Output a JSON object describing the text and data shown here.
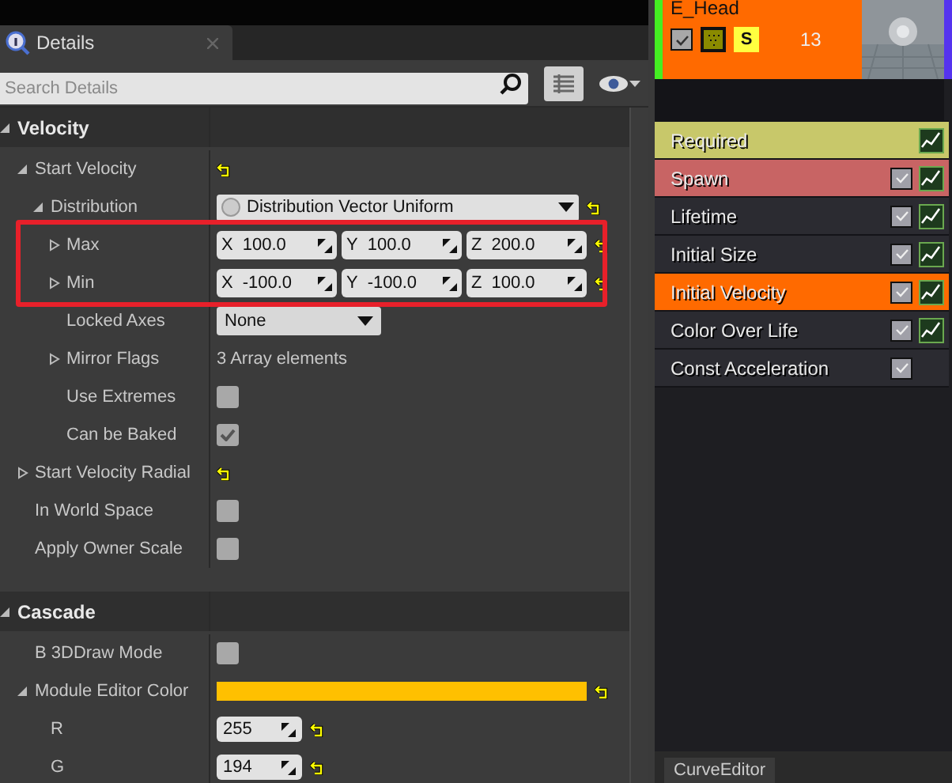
{
  "details": {
    "tab": "Details",
    "search": {
      "placeholder": "Search Details"
    },
    "sections": [
      {
        "title": "Velocity",
        "expanded": true,
        "rows": [
          {
            "label": "Start Velocity",
            "expanded": true,
            "kind": "none",
            "reset": true,
            "children": [
              {
                "label": "Distribution",
                "expanded": true,
                "kind": "dropdown",
                "value": "Distribution Vector Uniform",
                "reset": true,
                "children": [
                  {
                    "label": "Max",
                    "expanded": false,
                    "kind": "vector",
                    "highlighted": true,
                    "reset": true,
                    "values": [
                      {
                        "axis": "X",
                        "value": "100.0"
                      },
                      {
                        "axis": "Y",
                        "value": "100.0"
                      },
                      {
                        "axis": "Z",
                        "value": "200.0"
                      }
                    ]
                  },
                  {
                    "label": "Min",
                    "expanded": false,
                    "kind": "vector",
                    "highlighted": true,
                    "reset": true,
                    "values": [
                      {
                        "axis": "X",
                        "value": "-100.0"
                      },
                      {
                        "axis": "Y",
                        "value": "-100.0"
                      },
                      {
                        "axis": "Z",
                        "value": "100.0"
                      }
                    ]
                  },
                  {
                    "label": "Locked Axes",
                    "kind": "combo",
                    "value": "None"
                  },
                  {
                    "label": "Mirror Flags",
                    "expanded": false,
                    "kind": "text",
                    "value": "3 Array elements"
                  },
                  {
                    "label": "Use Extremes",
                    "kind": "checkbox",
                    "checked": false
                  },
                  {
                    "label": "Can be Baked",
                    "kind": "checkbox",
                    "checked": true
                  }
                ]
              }
            ]
          },
          {
            "label": "Start Velocity Radial",
            "expanded": false,
            "kind": "none",
            "reset": true
          },
          {
            "label": "In World Space",
            "kind": "checkbox",
            "checked": false
          },
          {
            "label": "Apply Owner Scale",
            "kind": "checkbox",
            "checked": false
          }
        ]
      },
      {
        "title": "Cascade",
        "expanded": true,
        "rows": [
          {
            "label": "B 3DDraw Mode",
            "kind": "checkbox",
            "checked": false
          },
          {
            "label": "Module Editor Color",
            "expanded": true,
            "kind": "color",
            "color": "#ffc000",
            "reset": true,
            "children": [
              {
                "label": "R",
                "kind": "number",
                "value": "255",
                "reset": true
              },
              {
                "label": "G",
                "kind": "number",
                "value": "194",
                "reset": true
              }
            ]
          }
        ]
      }
    ]
  },
  "emitter": {
    "name": "E_Head",
    "enabled": true,
    "solo": "S",
    "count": "13",
    "modules": [
      {
        "label": "Required",
        "kind": "fixed",
        "color": "#c8c86a",
        "selected": false,
        "curve": true
      },
      {
        "label": "Spawn",
        "kind": "toggle",
        "checked": true,
        "color": "#c86464",
        "selected": false,
        "curve": true
      },
      {
        "label": "Lifetime",
        "kind": "toggle",
        "checked": true,
        "color": "#2b2b31",
        "selected": false,
        "curve": true
      },
      {
        "label": "Initial Size",
        "kind": "toggle",
        "checked": true,
        "color": "#2b2b31",
        "selected": false,
        "curve": true
      },
      {
        "label": "Initial Velocity",
        "kind": "toggle",
        "checked": true,
        "selected": true,
        "curve": true
      },
      {
        "label": "Color Over Life",
        "kind": "toggle",
        "checked": true,
        "color": "#2b2b31",
        "selected": false,
        "curve": true
      },
      {
        "label": "Const Acceleration",
        "kind": "toggle",
        "checked": true,
        "color": "#2b2b31",
        "selected": false,
        "curve": false
      }
    ]
  },
  "bottom_tab": "CurveEditor"
}
